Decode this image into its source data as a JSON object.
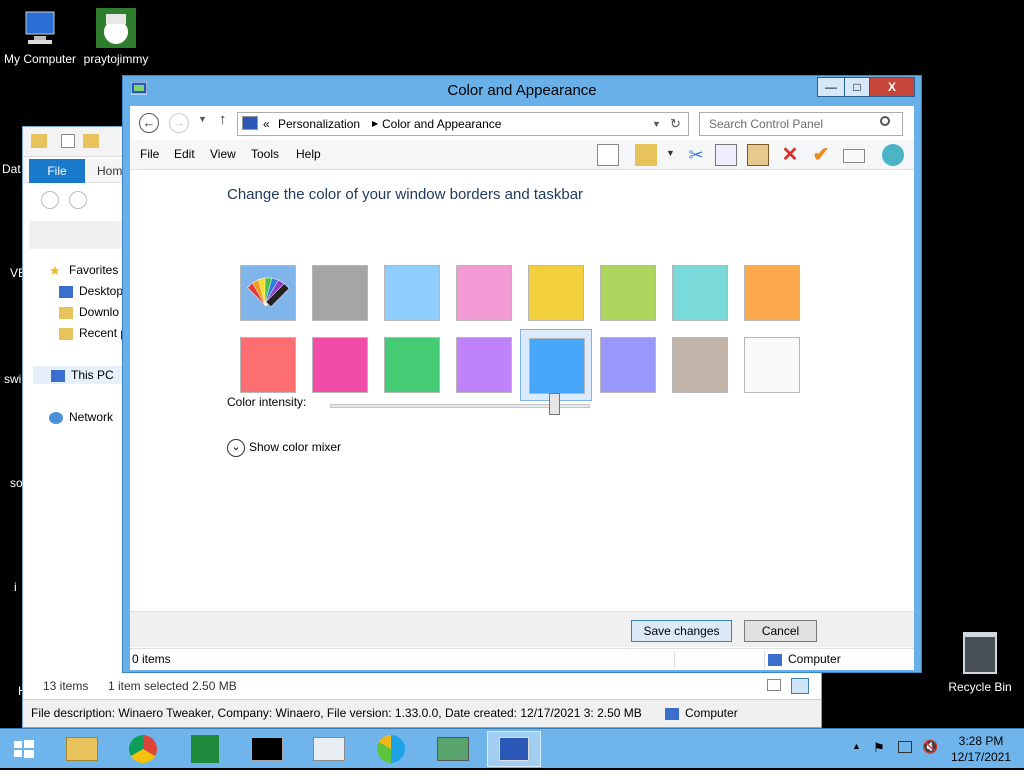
{
  "desktop": {
    "icons": [
      {
        "label": "My Computer"
      },
      {
        "label": "praytojimmy"
      }
    ],
    "partial_labels": [
      "Dat",
      "VE",
      "swi",
      "so",
      "i",
      "H"
    ],
    "recycle_bin": "Recycle Bin"
  },
  "explorer": {
    "tab_file": "File",
    "tab_home": "Hom",
    "favorites": "Favorites",
    "desktop": "Desktop",
    "downloads": "Downlo",
    "recent": "Recent p",
    "this_pc": "This PC",
    "network": "Network",
    "status_items": "13 items",
    "status_selected": "1 item selected  2.50 MB",
    "description": "File description: Winaero Tweaker, Company: Winaero, File version: 1.33.0.0, Date created: 12/17/2021 3: 2.50 MB",
    "location": "Computer"
  },
  "window": {
    "title": "Color and Appearance",
    "min": "—",
    "max": "□",
    "close": "X",
    "breadcrumb": {
      "prefix": "«",
      "items": [
        "Personalization",
        "Color and Appearance"
      ]
    },
    "search_placeholder": "Search Control Panel",
    "menu": [
      "File",
      "Edit",
      "View",
      "Tools",
      "Help"
    ],
    "heading": "Change the color of your window borders and taskbar",
    "swatches": [
      {
        "color": "automatic"
      },
      {
        "color": "#a5a5a5"
      },
      {
        "color": "#8ecdfc"
      },
      {
        "color": "#f29bd5"
      },
      {
        "color": "#f1cf3d"
      },
      {
        "color": "#acd65e"
      },
      {
        "color": "#7ad9d9"
      },
      {
        "color": "#fca84c"
      },
      {
        "color": "#fd6e70"
      },
      {
        "color": "#f04ca8"
      },
      {
        "color": "#45cb73"
      },
      {
        "color": "#bf82fb"
      },
      {
        "color": "#47a8fb"
      },
      {
        "color": "#9a98fd"
      },
      {
        "color": "#c2b3a9"
      },
      {
        "color": "#fafafa"
      }
    ],
    "selected_swatch": 12,
    "intensity_label": "Color intensity:",
    "intensity_value": 0.86,
    "mixer_label": "Show color mixer",
    "save": "Save changes",
    "cancel": "Cancel",
    "status_items": "0 items",
    "status_location": "Computer"
  },
  "taskbar": {
    "time": "3:28 PM",
    "date": "12/17/2021"
  }
}
